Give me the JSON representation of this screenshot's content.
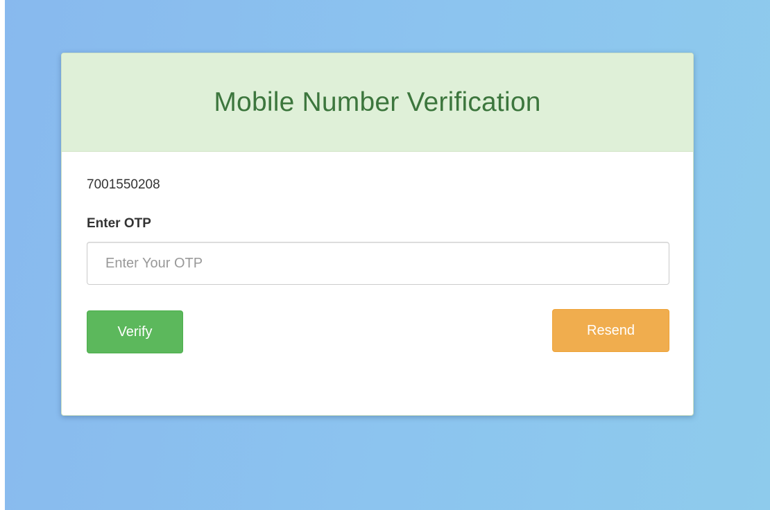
{
  "verification": {
    "title": "Mobile Number Verification",
    "mobile_number": "7001550208",
    "otp_label": "Enter OTP",
    "otp_input": {
      "value": "",
      "placeholder": "Enter Your OTP"
    },
    "verify_label": "Verify",
    "resend_label": "Resend"
  },
  "colors": {
    "heading_bg": "#dff0d8",
    "heading_text": "#3c763d",
    "verify_button": "#5cb85c",
    "resend_button": "#f0ad4e",
    "page_background": "#8cc4ef"
  }
}
